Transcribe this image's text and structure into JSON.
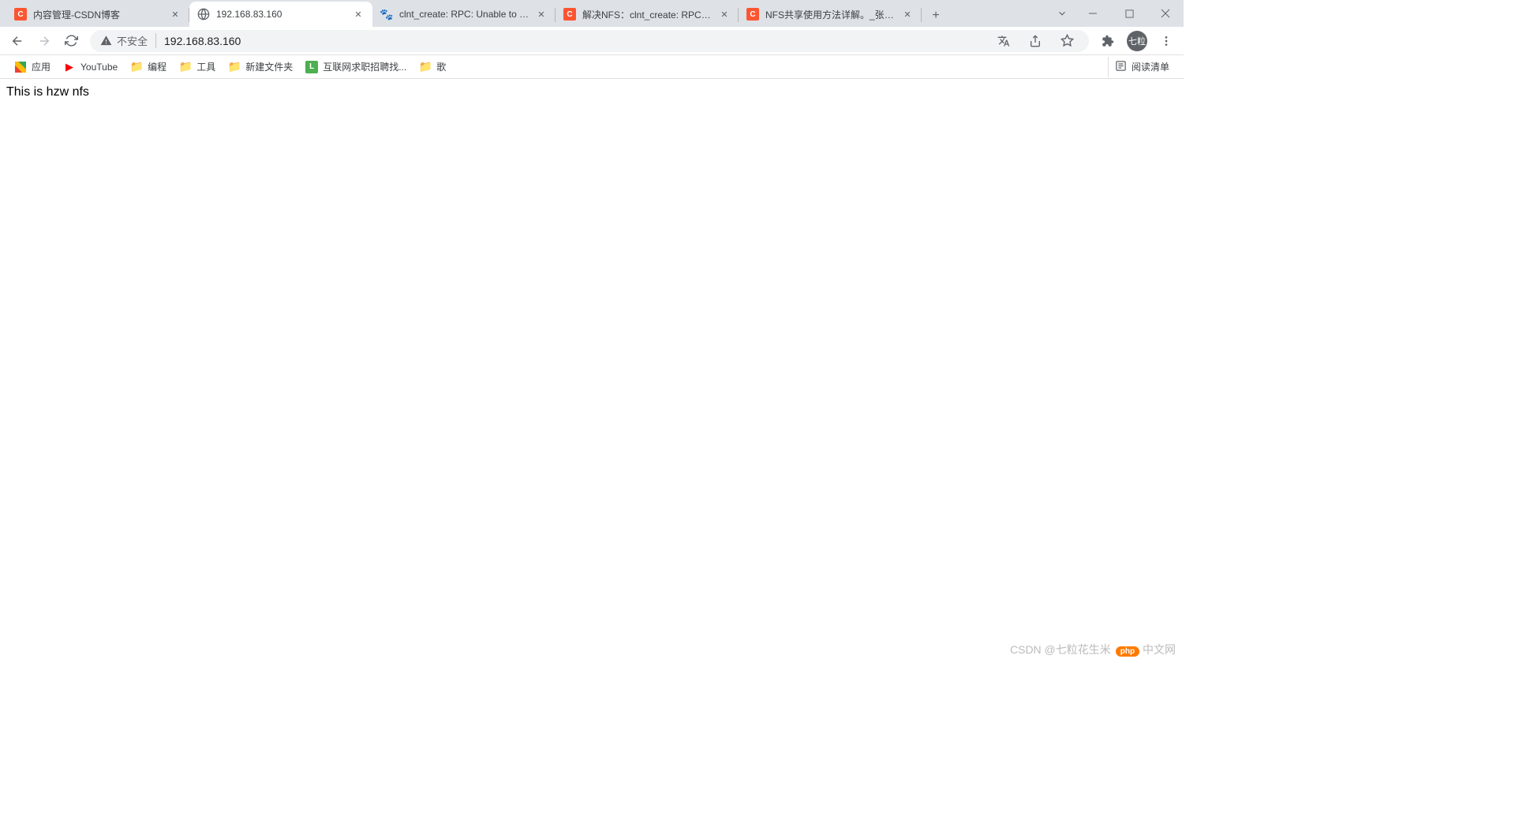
{
  "tabs": [
    {
      "title": "内容管理-CSDN博客",
      "favicon": "csdn"
    },
    {
      "title": "192.168.83.160",
      "favicon": "globe"
    },
    {
      "title": "clnt_create: RPC: Unable to rec",
      "favicon": "baidu"
    },
    {
      "title": "解决NFS：clnt_create: RPC: Po",
      "favicon": "csdn"
    },
    {
      "title": "NFS共享使用方法详解。_张必安",
      "favicon": "csdn"
    }
  ],
  "omnibox": {
    "security_text": "不安全",
    "url": "192.168.83.160"
  },
  "bookmarks": [
    {
      "label": "应用",
      "icon": "apps"
    },
    {
      "label": "YouTube",
      "icon": "youtube"
    },
    {
      "label": "编程",
      "icon": "folder"
    },
    {
      "label": "工具",
      "icon": "folder"
    },
    {
      "label": "新建文件夹",
      "icon": "folder"
    },
    {
      "label": "互联网求职招聘找...",
      "icon": "l"
    },
    {
      "label": "歌",
      "icon": "folder"
    }
  ],
  "reading_list_label": "阅读清单",
  "avatar_text": "七粒",
  "page_content": "This is hzw nfs",
  "watermark": {
    "php": "php",
    "cn": "中文网",
    "csdn": "CSDN @七粒花生米"
  }
}
